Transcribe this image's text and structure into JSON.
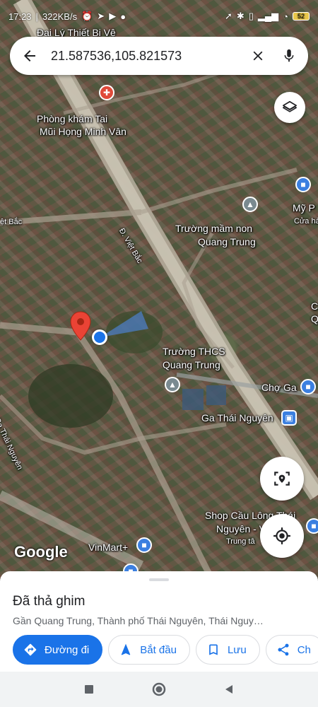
{
  "status_bar": {
    "time": "17:23",
    "speed": "322KB/s",
    "battery": "52"
  },
  "search": {
    "query": "21.587536,105.821573"
  },
  "map_labels": {
    "dai_ly": "Đại Lý Thiết Bị Vệ",
    "phong_kham_1": "Phòng khám Tai",
    "phong_kham_2": "Mũi Họng Minh Vân",
    "street_viet_bac": "Đ. Việt Bắc",
    "street_left": "ệt Bắc",
    "truong_mam_non_1": "Trường mầm non",
    "truong_mam_non_2": "Quang Trung",
    "my_1": "Mỹ P",
    "my_2": "Cửa hà",
    "thcs_1": "Trường THCS",
    "thcs_2": "Quang Trung",
    "cho_ga": "Chợ Ga",
    "ga_thai_nguyen": "Ga Thái Nguyên",
    "street_ga": "Ga Thái Nguyên",
    "shop_1": "Shop Cầu Lông Thái",
    "shop_2": "Nguyên - VN",
    "trung_tam": "Trung tâ",
    "vinmart": "VinMart+",
    "edge_c": "C",
    "edge_q": "Q",
    "google": "Google"
  },
  "sheet": {
    "title": "Đã thả ghim",
    "address": "Gần Quang Trung, Thành phố Thái Nguyên, Thái Nguy…",
    "actions": {
      "directions": "Đường đi",
      "start": "Bắt đầu",
      "save": "Lưu",
      "share": "Ch"
    }
  },
  "colors": {
    "accent": "#1a73e8",
    "pin": "#ea4335",
    "my_location": "#1a73e8"
  }
}
